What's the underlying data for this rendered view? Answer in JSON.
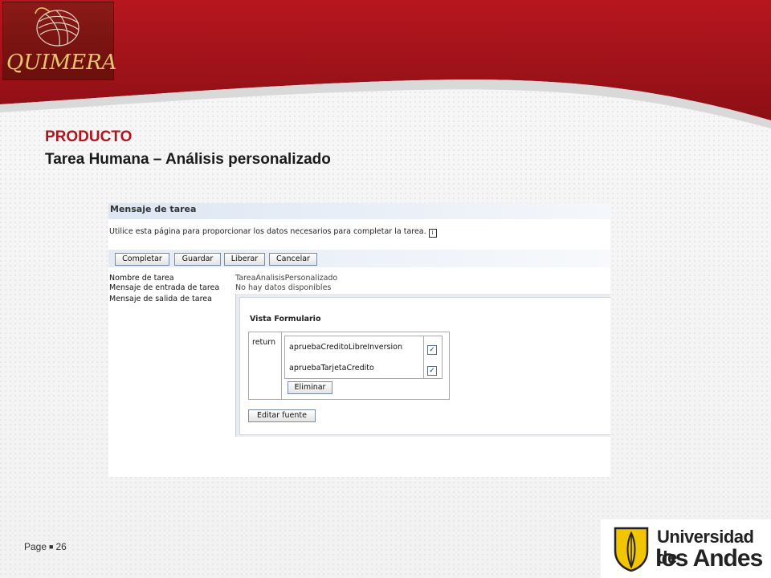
{
  "slide": {
    "logo_text": "QUIMERA",
    "title": "PRODUCTO",
    "subtitle": "Tarea Humana – Análisis personalizado",
    "page_label": "Page",
    "page_number": "26",
    "university_line1": "Universidad de",
    "university_line2": "los Andes",
    "colors": {
      "header_red": "#a5141d",
      "title_red": "#b0151f",
      "logo_gold": "#e7c56a"
    }
  },
  "task": {
    "title": "Mensaje de tarea",
    "description": "Utilice esta página para proporcionar los datos necesarios para completar la tarea.",
    "info_icon": "i",
    "toolbar": {
      "complete": "Completar",
      "save": "Guardar",
      "release": "Liberar",
      "cancel": "Cancelar"
    },
    "fields": {
      "name_label": "Nombre de tarea",
      "name_value": "TareaAnalisisPersonalizado",
      "input_label": "Mensaje de entrada de tarea",
      "input_value": "No hay datos disponibles",
      "output_label": "Mensaje de salida de tarea"
    },
    "form": {
      "title": "Vista Formulario",
      "return_label": "return",
      "items": [
        {
          "label": "apruebaCreditoLibreInversion",
          "checked": true
        },
        {
          "label": "apruebaTarjetaCredito",
          "checked": true
        }
      ],
      "delete_button": "Eliminar",
      "edit_source_button": "Editar fuente"
    }
  }
}
